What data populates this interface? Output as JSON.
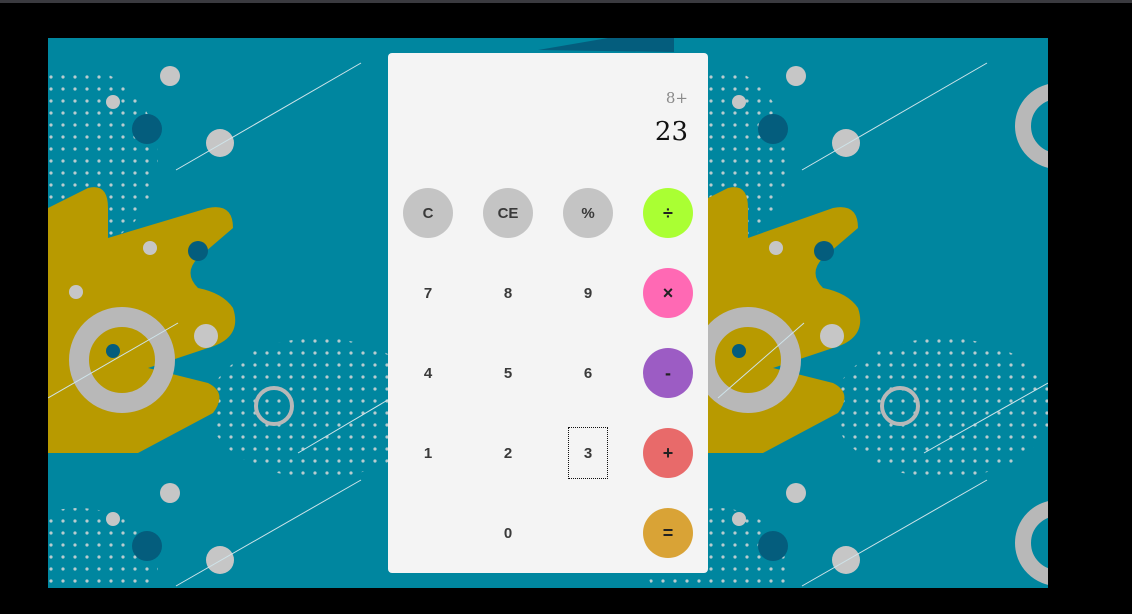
{
  "display": {
    "expression": "8+",
    "result": "23"
  },
  "keys": {
    "clear": "C",
    "clear_entry": "CE",
    "percent": "%",
    "divide": "÷",
    "seven": "7",
    "eight": "8",
    "nine": "9",
    "multiply": "×",
    "four": "4",
    "five": "5",
    "six": "6",
    "subtract": "-",
    "one": "1",
    "two": "2",
    "three": "3",
    "add": "+",
    "zero": "0",
    "equals": "="
  },
  "colors": {
    "function_keys": "#c4c4c4",
    "divide": "#aaff33",
    "multiply": "#ff69b4",
    "subtract": "#9c5cc4",
    "add": "#e86a6a",
    "equals": "#d9a336",
    "background": "#00869f"
  }
}
